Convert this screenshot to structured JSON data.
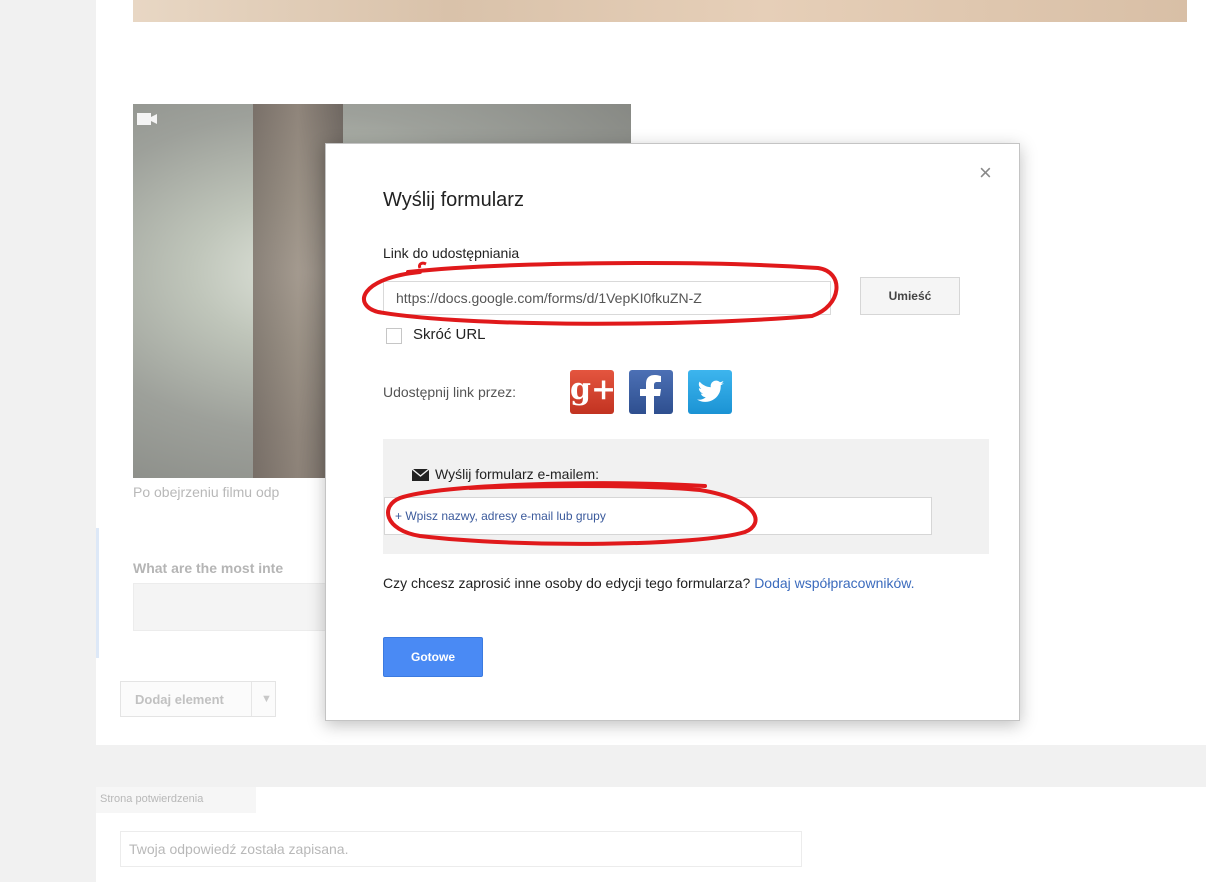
{
  "background": {
    "video_caption": "Po obejrzeniu filmu odp",
    "question_title": "What are the most inte",
    "add_element_label": "Dodaj element",
    "confirmation_tab": "Strona potwierdzenia",
    "confirmation_placeholder": "Twoja odpowiedź została zapisana."
  },
  "dialog": {
    "title": "Wyślij formularz",
    "link_label": "Link do udostępniania",
    "link_value": "https://docs.google.com/forms/d/1VepKI0fkuZN-Z",
    "embed_button": "Umieść",
    "shorten_url_label": "Skróć URL",
    "shorten_url_checked": false,
    "share_via_label": "Udostępnij link przez:",
    "share_icons": [
      "google-plus-icon",
      "facebook-icon",
      "twitter-icon"
    ],
    "email_section_label": "Wyślij formularz e-mailem:",
    "email_placeholder": "+ Wpisz nazwy, adresy e-mail lub grupy",
    "invite_text": "Czy chcesz zaprosić inne osoby do edycji tego formularza?",
    "invite_link": "Dodaj współpracowników.",
    "done_button": "Gotowe",
    "close_glyph": "×"
  },
  "colors": {
    "primary_button": "#4a8af4",
    "link": "#3b6bbd",
    "annotation": "#e0191b"
  }
}
